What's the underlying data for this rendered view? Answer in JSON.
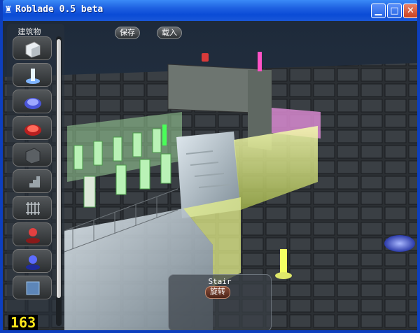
{
  "window": {
    "title": "Roblade 0.5 beta",
    "minimize_label": "▁",
    "maximize_label": "□",
    "close_label": "✕"
  },
  "toolbar": {
    "save_label": "保存",
    "load_label": "载入"
  },
  "sidebar": {
    "title": "建筑物",
    "items": [
      {
        "icon": "cube-block-icon"
      },
      {
        "icon": "light-pillar-icon"
      },
      {
        "icon": "blue-pad-icon"
      },
      {
        "icon": "red-pad-icon"
      },
      {
        "icon": "dark-block-icon"
      },
      {
        "icon": "stair-icon"
      },
      {
        "icon": "fence-icon"
      },
      {
        "icon": "red-post-icon"
      },
      {
        "icon": "blue-post-icon"
      },
      {
        "icon": "ice-block-icon"
      }
    ]
  },
  "fps": "163",
  "selection": {
    "name": "Stair",
    "rotate_label": "旋转"
  },
  "colors": {
    "titlebar": "#0a4bd6",
    "floor": "#2d3135",
    "fps_text": "#ffe81a",
    "glow_green": "#7dff7a",
    "glow_pink": "#ff5fd0",
    "glow_yellow": "#f4ff6a"
  }
}
